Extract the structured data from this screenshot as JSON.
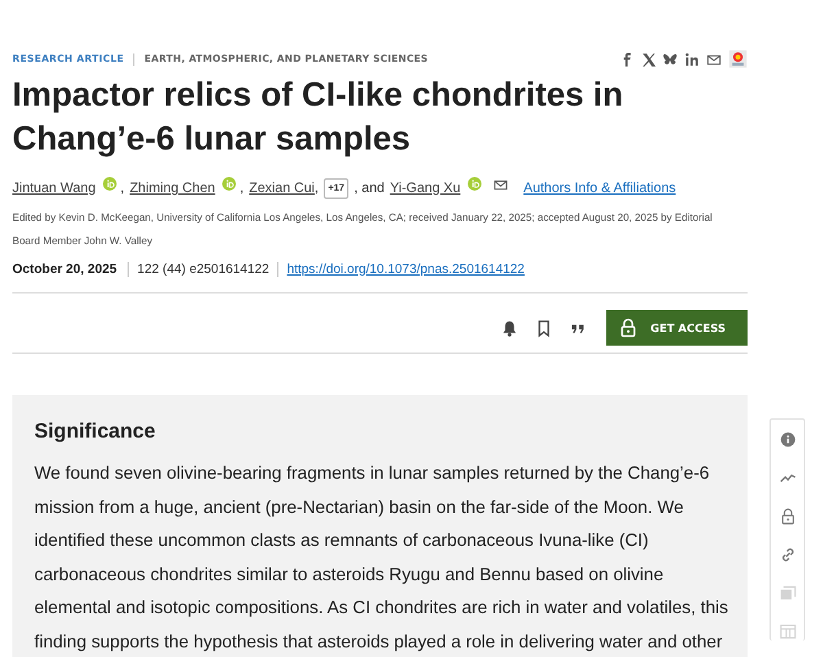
{
  "header": {
    "article_type": "RESEARCH ARTICLE",
    "section": "EARTH, ATMOSPHERIC, AND PLANETARY SCIENCES",
    "share_icons": [
      {
        "kind": "facebook"
      },
      {
        "kind": "x"
      },
      {
        "kind": "bluesky"
      },
      {
        "kind": "linkedin"
      },
      {
        "kind": "email"
      },
      {
        "kind": "badge"
      }
    ]
  },
  "title": "Impactor relics of CI-like chondrites in Chang’e-6 lunar samples",
  "authors": [
    {
      "name": "Jintuan Wang",
      "orcid": true,
      "separator": ","
    },
    {
      "name": "Zhiming Chen",
      "orcid": true,
      "separator": ","
    },
    {
      "name": "Zexian Cui",
      "orcid": false,
      "separator": ","
    },
    {
      "kind": "more",
      "label": "+17"
    },
    {
      "kind": "conjunction",
      "label": ", and"
    },
    {
      "name": "Yi-Gang Xu",
      "orcid": true,
      "email": true
    }
  ],
  "affiliations_link": "Authors Info & Affiliations",
  "edited_by": "Edited by Kevin D. McKeegan, University of California Los Angeles, Los Angeles, CA; received January 22, 2025; accepted August 20, 2025 by Editorial Board Member John W. Valley",
  "publication": {
    "date": "October 20, 2025",
    "citation": "122 (44) e2501614122",
    "doi": "https://doi.org/10.1073/pnas.2501614122"
  },
  "actions": [
    {
      "kind": "alert"
    },
    {
      "kind": "bookmark"
    },
    {
      "kind": "cite"
    }
  ],
  "access_button": "GET ACCESS",
  "significance": {
    "heading": "Significance",
    "text": "We found seven olivine-bearing fragments in lunar samples returned by the Chang’e-6 mission from a huge, ancient (pre-Nectarian) basin on the far-side of the Moon. We identified these uncommon clasts as remnants of carbonaceous Ivuna-like (CI) carbonaceous chondrites similar to asteroids Ryugu and Bennu based on olivine elemental and isotopic compositions. As CI chondrites are rich in water and volatiles, this finding supports the hypothesis that asteroids played a role in delivering water and other"
  },
  "sidebar": [
    {
      "kind": "info",
      "disabled": false
    },
    {
      "kind": "metrics",
      "disabled": false
    },
    {
      "kind": "access",
      "disabled": false
    },
    {
      "kind": "link",
      "disabled": false
    },
    {
      "kind": "figures",
      "disabled": true
    },
    {
      "kind": "tables",
      "disabled": true
    }
  ]
}
